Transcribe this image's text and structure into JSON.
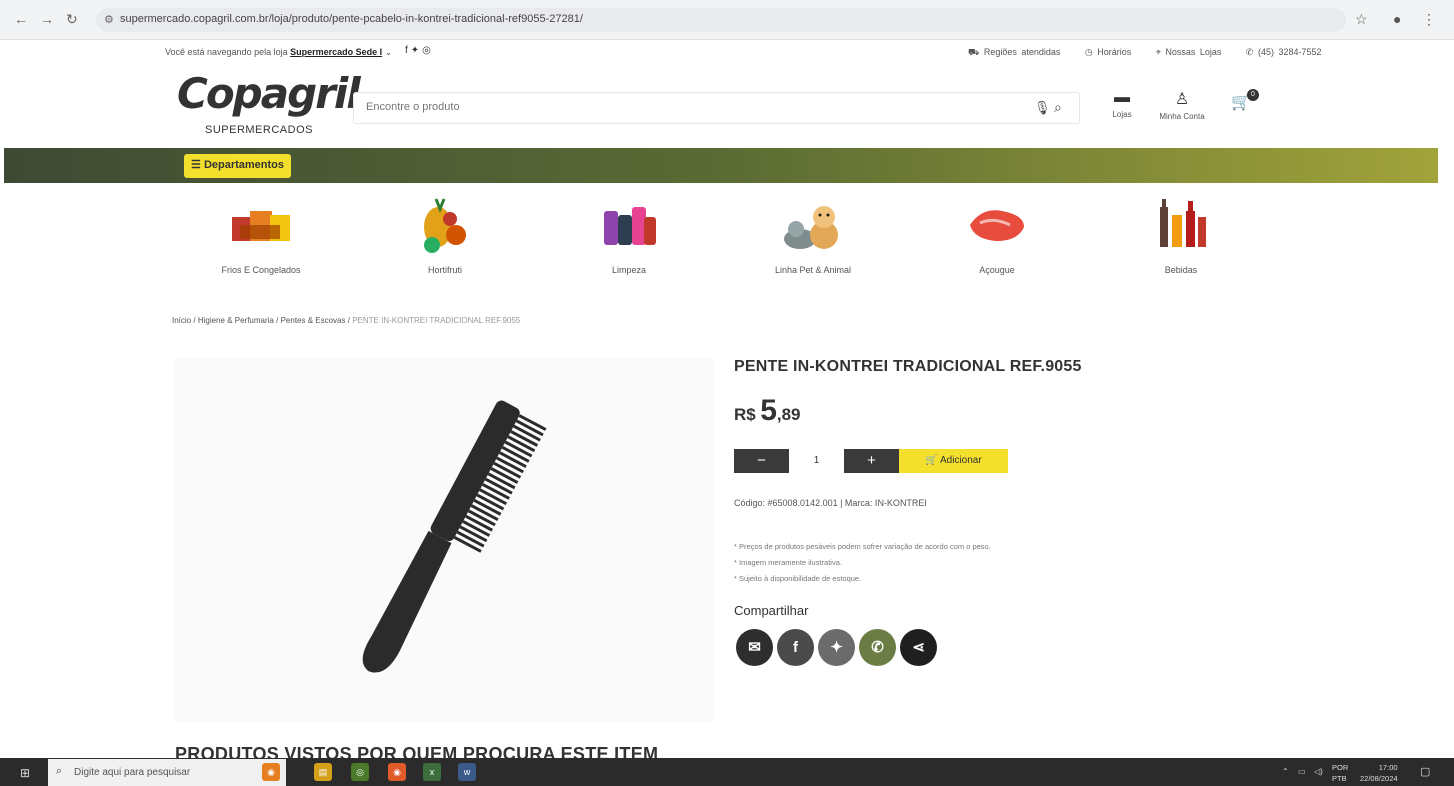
{
  "browser": {
    "url": "supermercado.copagril.com.br/loja/produto/pente-pcabelo-in-kontrei-tradicional-ref9055-27281/"
  },
  "topbar": {
    "browsing_prefix": "Você está navegando pela loja",
    "store_name": "Supermercado Sede I",
    "regions": "Regiões atendidas",
    "hours": "Horários",
    "stores": "Nossas Lojas",
    "phone": "(45) 3284-7552"
  },
  "header": {
    "logo": "Copagril",
    "logo_sub": "SUPERMERCADOS",
    "search_placeholder": "Encontre o produto",
    "stores_label": "Lojas",
    "account_label": "Minha Conta",
    "cart_count": "0"
  },
  "menu": {
    "departments_label": "Departamentos"
  },
  "categories": [
    {
      "label": "Frios E Congelados",
      "icon": "frozen-food-icon"
    },
    {
      "label": "Hortifruti",
      "icon": "fruits-icon"
    },
    {
      "label": "Limpeza",
      "icon": "cleaning-products-icon"
    },
    {
      "label": "Linha Pet & Animal",
      "icon": "pet-icon"
    },
    {
      "label": "Açougue",
      "icon": "meat-icon"
    },
    {
      "label": "Bebidas",
      "icon": "drinks-icon"
    }
  ],
  "breadcrumb": {
    "home": "Início",
    "cat1": "Higiene & Perfumaria",
    "cat2": "Pentes & Escovas",
    "current": "PENTE IN-KONTREI TRADICIONAL REF.9055",
    "sep": "/"
  },
  "product": {
    "title": "PENTE IN-KONTREI TRADICIONAL REF.9055",
    "currency": "R$",
    "price_int": "5",
    "price_dec": ",89",
    "qty": "1",
    "minus": "−",
    "plus": "+",
    "add_label": "Adicionar",
    "code": "Código: #65008.0142.001 | Marca: IN-KONTREI",
    "notes": [
      "* Preços de produtos pesáveis podem sofrer variação de acordo com o peso.",
      "* Imagem meramente ilustrativa.",
      "* Sujeito à disponibilidade de estoque."
    ],
    "share_label": "Compartilhar"
  },
  "section_title": "PRODUTOS VISTOS POR QUEM PROCURA ESTE ITEM",
  "taskbar": {
    "search_placeholder": "Digite aqui para pesquisar",
    "lang": "POR",
    "lang2": "PTB",
    "time": "17:00",
    "date": "22/08/2024"
  },
  "colors": {
    "accent_yellow": "#f2e02d",
    "menu_dark": "#3e4a34",
    "menu_light": "#a1a33a",
    "dark_button": "#3a3a3a"
  }
}
